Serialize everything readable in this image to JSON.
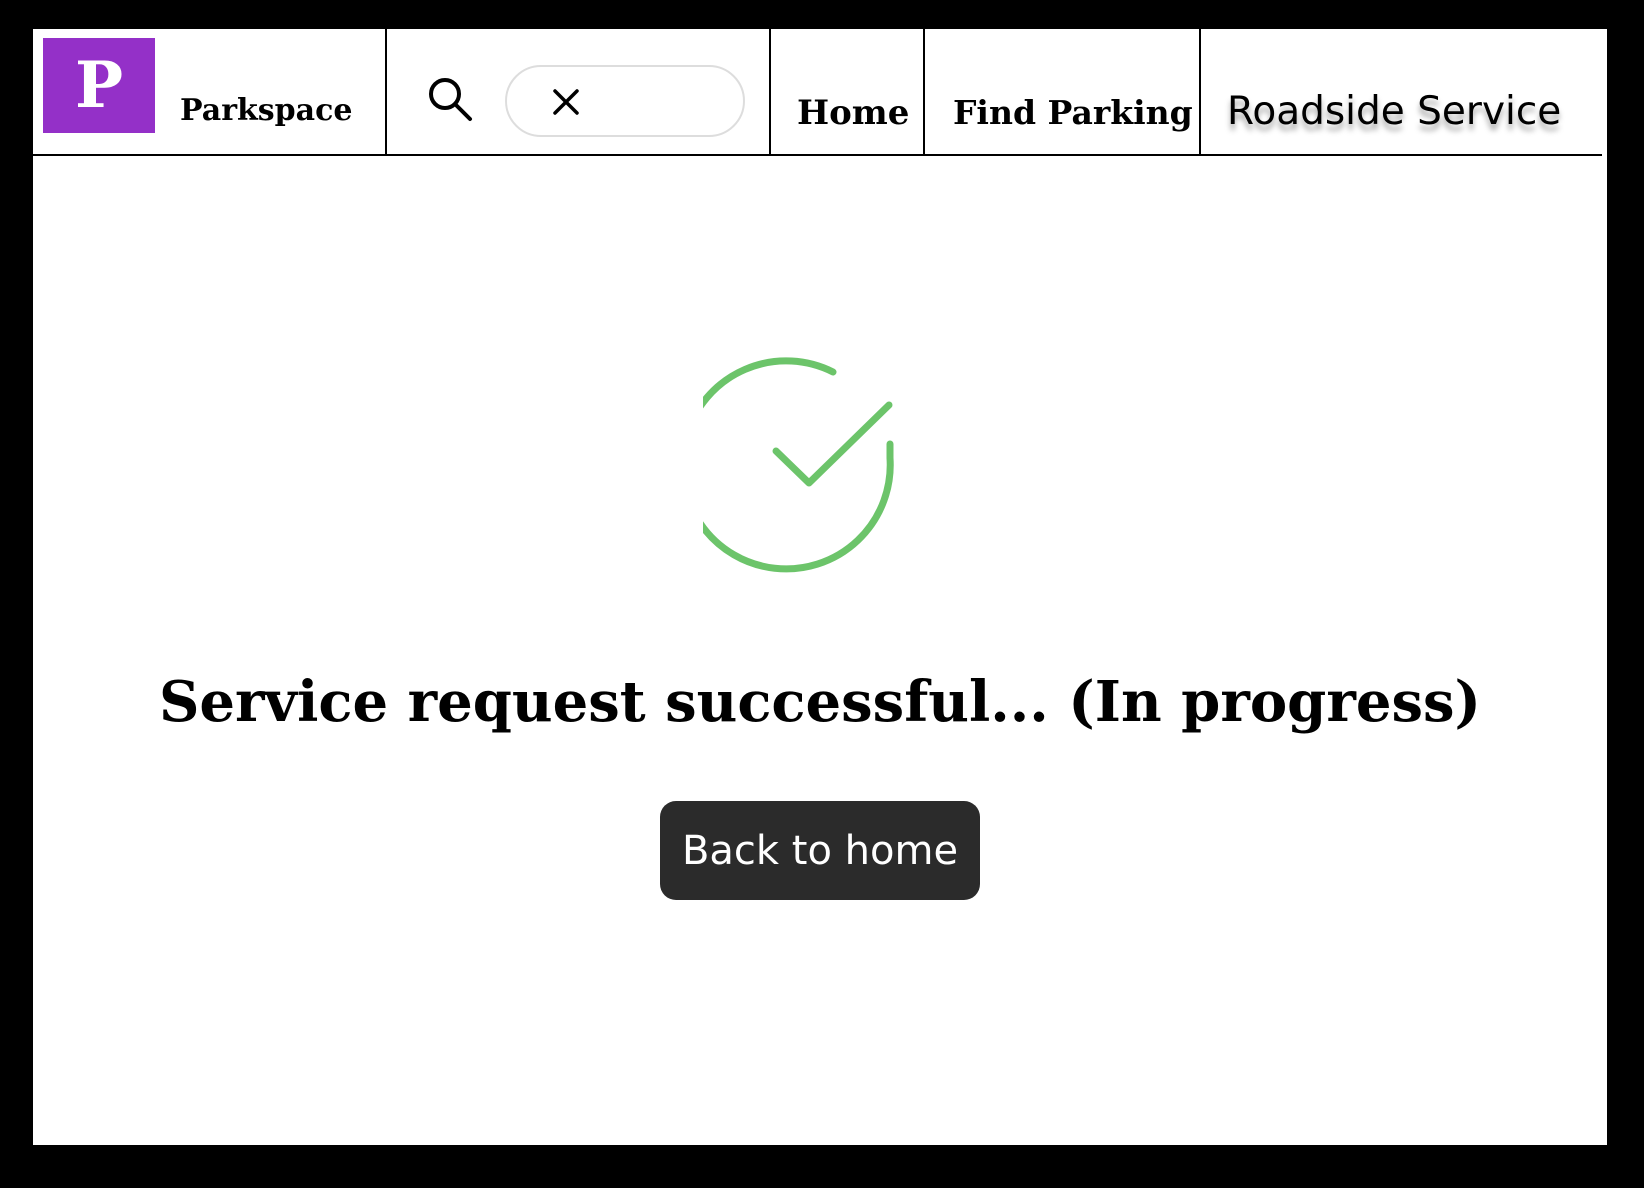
{
  "header": {
    "logo_letter": "P",
    "brand_name": "Parkspace",
    "search": {
      "value": "",
      "icon": "search-icon",
      "clear_icon": "close-icon"
    },
    "nav": {
      "home": "Home",
      "find_parking": "Find Parking",
      "roadside_service": "Roadside Service"
    }
  },
  "main": {
    "status_icon": "check-circle-icon",
    "message": "Service request successful... (In progress)",
    "back_button_label": "Back to home"
  },
  "colors": {
    "brand": "#9430c8",
    "success": "#6cc46a",
    "button_bg": "#2b2b2b"
  }
}
